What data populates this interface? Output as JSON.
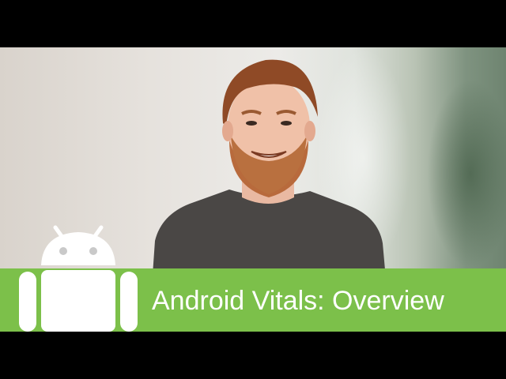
{
  "banner": {
    "title": "Android Vitals: Overview",
    "background_color": "#7cc04a",
    "text_color": "#ffffff"
  },
  "logo": {
    "icon": "android-robot-icon",
    "color": "#ffffff"
  },
  "scene": {
    "subject": "presenter-person",
    "letterbox_color": "#000000"
  }
}
